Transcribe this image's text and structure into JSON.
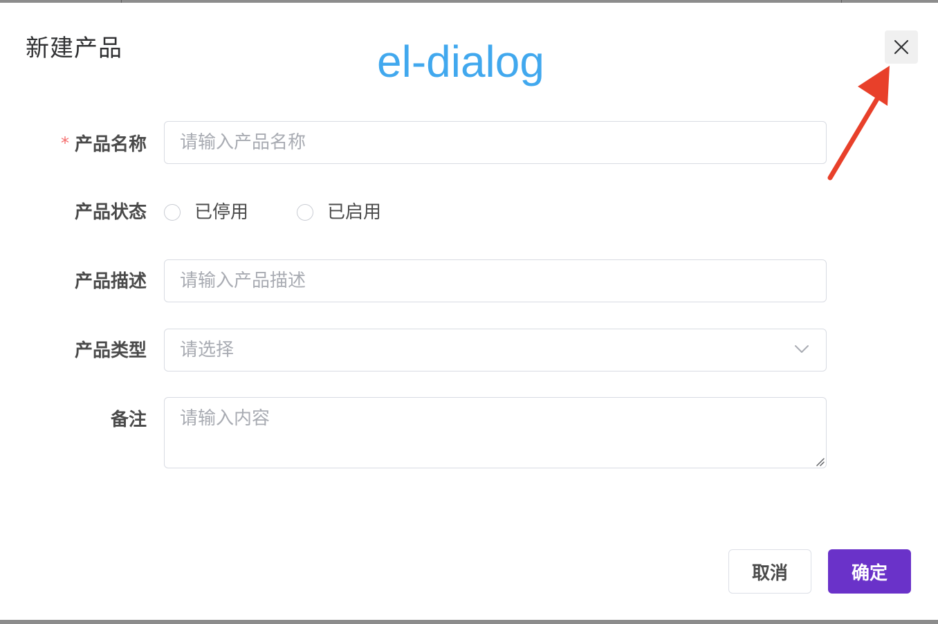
{
  "dialog": {
    "title": "新建产品",
    "watermark": "el-dialog",
    "close_icon": "close-icon"
  },
  "form": {
    "name": {
      "label": "产品名称",
      "required_mark": "*",
      "placeholder": "请输入产品名称",
      "value": ""
    },
    "status": {
      "label": "产品状态",
      "options": [
        {
          "label": "已停用",
          "selected": false
        },
        {
          "label": "已启用",
          "selected": false
        }
      ]
    },
    "description": {
      "label": "产品描述",
      "placeholder": "请输入产品描述",
      "value": ""
    },
    "type": {
      "label": "产品类型",
      "placeholder": "请选择",
      "value": ""
    },
    "remark": {
      "label": "备注",
      "placeholder": "请输入内容",
      "value": ""
    }
  },
  "footer": {
    "cancel_label": "取消",
    "confirm_label": "确定"
  },
  "colors": {
    "primary": "#6a32c9",
    "watermark": "#41a8ee",
    "required": "#f56c6c",
    "arrow": "#e8402a"
  }
}
